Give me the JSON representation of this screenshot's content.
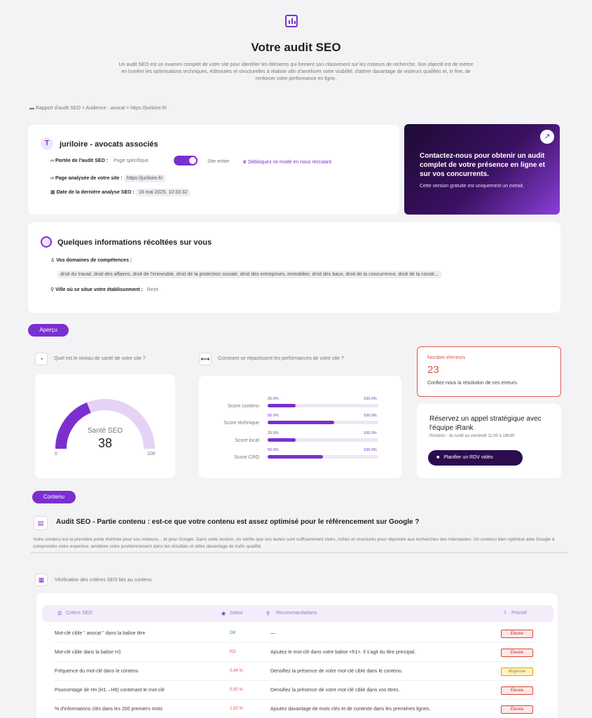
{
  "header": {
    "title": "Votre audit SEO",
    "intro": "Un audit SEO est un examen complet de votre site pour identifier les éléments qui freinent son classement sur les moteurs de recherche. Son objectif est de mettre en lumière les optimisations techniques, éditoriales et structurelles à réaliser afin d'améliorer votre visibilité, d'attirer davantage de visiteurs qualifiés et, in fine, de renforcer votre performance en ligne."
  },
  "breadcrumb": {
    "items": [
      "Rapport d'audit SEO",
      "Audience : avocat",
      "https://juriloire.fr/"
    ],
    "sep": ">"
  },
  "site": {
    "initial": "T",
    "name": "juriloire - avocats associés",
    "scope_label": "Portée de l'audit SEO :",
    "scope_left": "Page spécifique",
    "scope_right": "Site entier",
    "unlock": "Débloquez ce mode en nous recrutant",
    "page_label": "Page analysée de votre site :",
    "page_value": "https://juriloire.fr/",
    "date_label": "Date de la dernière analyse SEO :",
    "date_value": "16 mai 2025, 10:33:32"
  },
  "promo": {
    "title": "Contactez-nous pour obtenir un audit complet de votre présence en ligne et sur vos concurrents.",
    "subtitle": "Cette version gratuite est uniquement un extrait."
  },
  "info": {
    "title": "Quelques informations récoltées sur vous",
    "domains_label": "Vos domaines de compétences :",
    "domains_value": "droit du travail, droit des affaires, droit de l'immeuble, droit de la protection sociale, droit des entreprises, immobilier, droit des baux, droit de la concurrence, droit de la constr...",
    "city_label": "Ville où se situe votre établissement :",
    "city_value": "Rezé"
  },
  "apercu": {
    "tag": "Aperçu",
    "health_q": "Quel est le niveau de santé de votre site ?",
    "perf_q": "Comment se répartissent les performances de votre site ?",
    "gauge_label": "Santé SEO",
    "gauge_value": 38,
    "gauge_value_text": "38",
    "gauge_min": "0",
    "gauge_max": "100",
    "scores": [
      {
        "label": "Score contenu",
        "left": "25.0%",
        "right": "100.0%",
        "pct": 25
      },
      {
        "label": "Score technique",
        "left": "60.0%",
        "right": "100.0%",
        "pct": 60
      },
      {
        "label": "Score local",
        "left": "25.0%",
        "right": "100.0%",
        "pct": 25
      },
      {
        "label": "Score CRO",
        "left": "50.0%",
        "right": "100.0%",
        "pct": 50
      }
    ],
    "errors_title": "Nombre d'erreurs",
    "errors_count": "23",
    "errors_text": "Confiez-nous la résolution de ces erreurs.",
    "call_title": "Réservez un appel stratégique avec l'équipe iRank",
    "call_hours": "Horaires : du lundi au vendredi 11:00 à 18h30",
    "call_button": "Planifier un RDV vidéo"
  },
  "contenu": {
    "tag": "Contenu",
    "title": "Audit SEO - Partie contenu : est-ce que votre contenu est assez optimisé pour le référencement sur Google ?",
    "desc": "Votre contenu est la première porte d'entrée pour vos visiteurs... et pour Google. Dans cette section, on vérifie que vos textes sont suffisamment clairs, riches et structurés pour répondre aux recherches des internautes. Un contenu bien optimisé aide Google à comprendre votre expertise, améliore votre positionnement dans les résultats et attire davantage de trafic qualifié.",
    "criteria_title": "Vérification des critères SEO liés au contenu",
    "table_headers": [
      "Critère SEO",
      "Statut",
      "Recommandations",
      "Priorité"
    ],
    "rows": [
      {
        "crit": "Mot-clé cible \" avocat \" dans la balise titre",
        "status": "OK",
        "reco": "—",
        "prio": "Élevée",
        "level": "high"
      },
      {
        "crit": "Mot-clé cible dans la balise H1",
        "status": "KO",
        "reco": "Ajoutez le mot-clé dans votre balise <h1>. Il s'agit du titre principal.",
        "prio": "Élevée",
        "level": "high"
      },
      {
        "crit": "Fréquence du mot-clé dans le contenu",
        "status": "0,44 %",
        "reco": "Densifiez la présence de votre mot-clé cible dans le contenu.",
        "prio": "Moyenne",
        "level": "mid"
      },
      {
        "crit": "Pourcentage de Hn (H1→H6) contenant le mot-clé",
        "status": "0,00 %",
        "reco": "Densifiez la présence de votre mot-clé cible dans vos titres.",
        "prio": "Élevée",
        "level": "high"
      },
      {
        "crit": "% d'informations clés dans les 200 premiers mots",
        "status": "1,50 %",
        "reco": "Ajoutez davantage de mots clés et de contexte dans les premières lignes.",
        "prio": "Élevée",
        "level": "high"
      }
    ]
  },
  "colors": {
    "accent": "#7b2fd0",
    "error": "#d9534f",
    "ok": "#2a9d4a"
  }
}
